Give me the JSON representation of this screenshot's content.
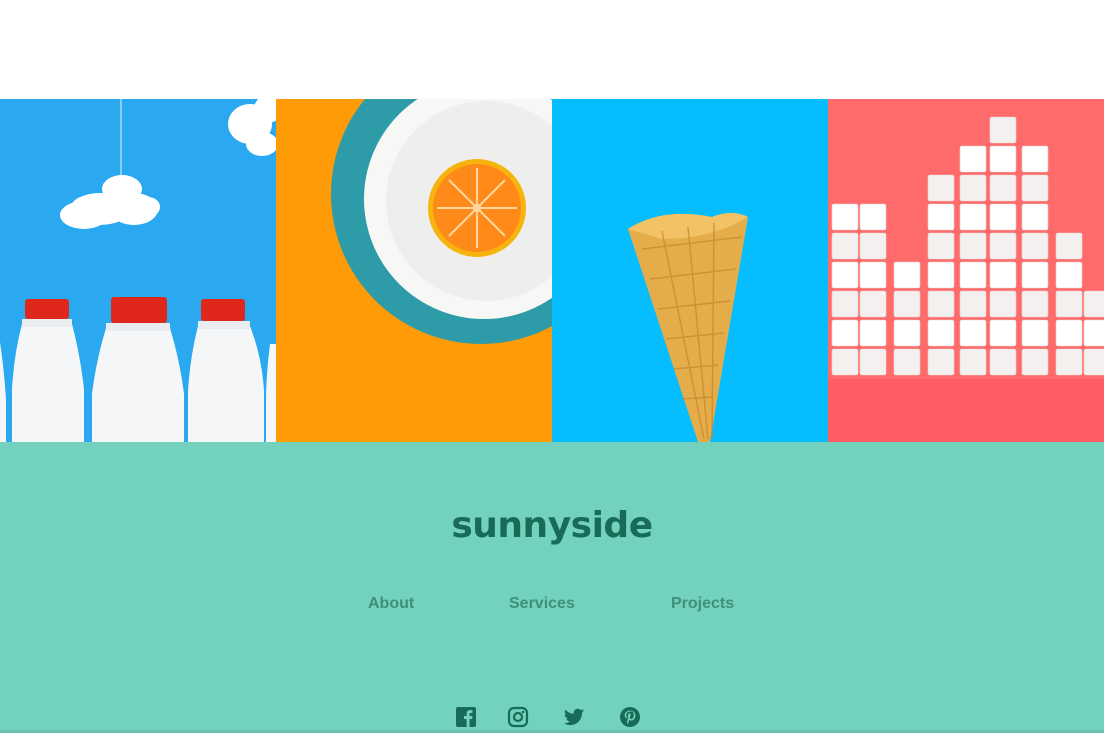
{
  "gallery": {
    "items": [
      {
        "icon": "milk-bottles-image",
        "bg": "#2aa8f0"
      },
      {
        "icon": "orange-plate-image",
        "bg": "#ff9b06"
      },
      {
        "icon": "ice-cream-cone-image",
        "bg": "#06bdff"
      },
      {
        "icon": "sugar-cubes-image",
        "bg": "#ff6b6b"
      }
    ]
  },
  "footer": {
    "logo": "sunnyside",
    "nav": {
      "about": "About",
      "services": "Services",
      "projects": "Projects"
    },
    "social": [
      {
        "icon": "facebook-icon"
      },
      {
        "icon": "instagram-icon"
      },
      {
        "icon": "twitter-icon"
      },
      {
        "icon": "pinterest-icon"
      }
    ],
    "colors": {
      "background": "#72d2bd",
      "logo": "#186b58",
      "nav": "#3f8f7d"
    }
  }
}
